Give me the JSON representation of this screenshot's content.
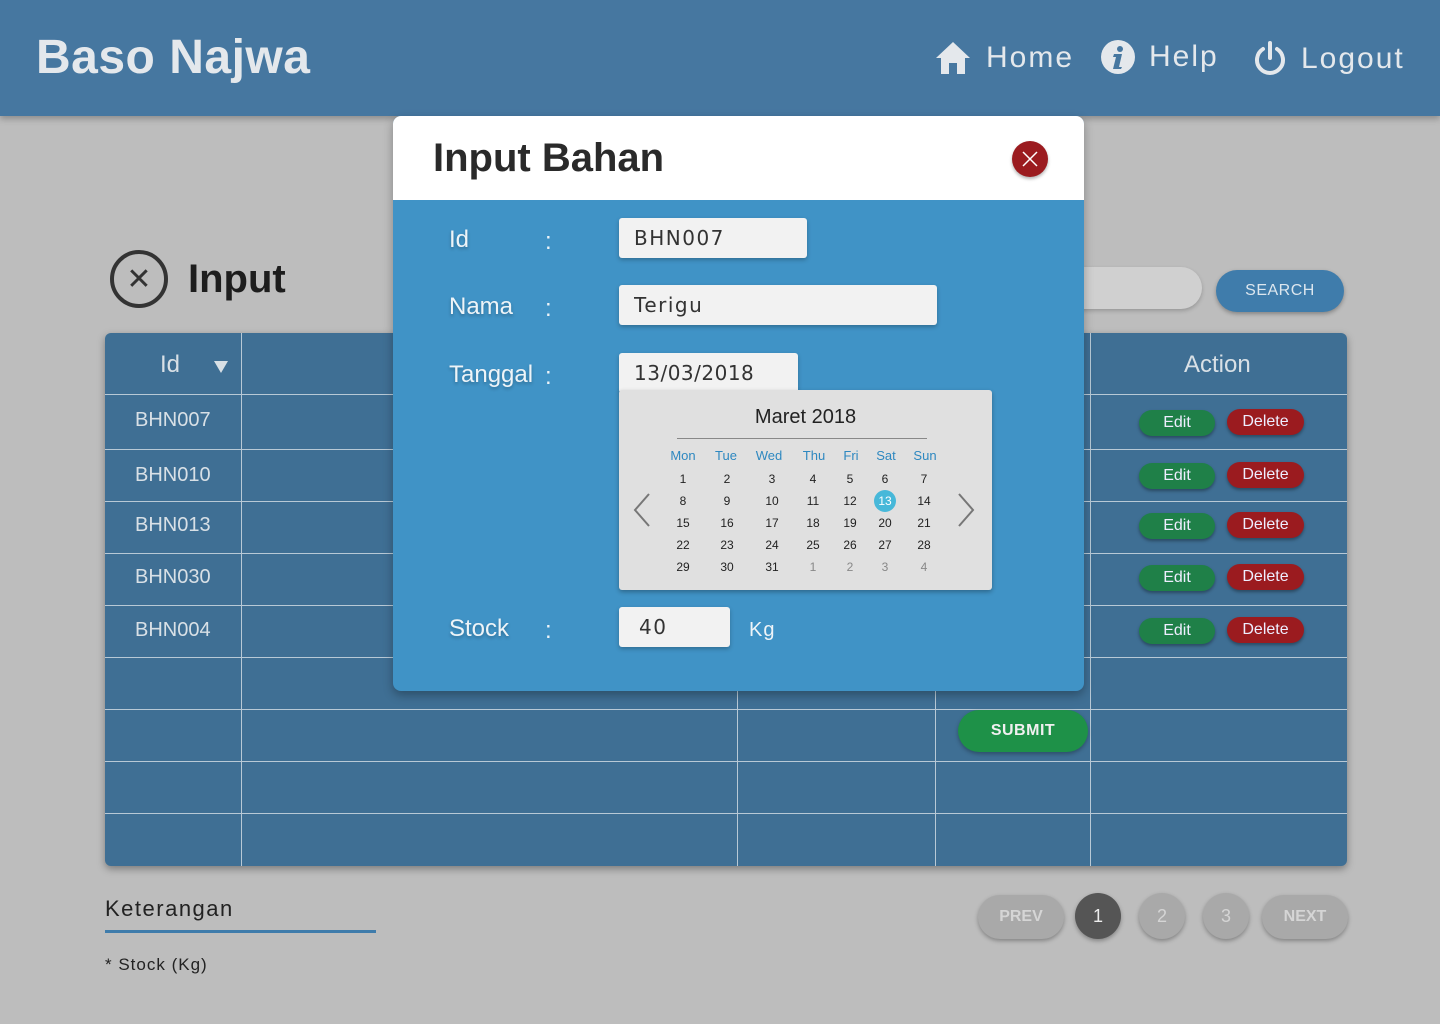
{
  "brand": "Baso Najwa",
  "nav": {
    "home": "Home",
    "help": "Help",
    "logout": "Logout"
  },
  "page": {
    "title": "Input",
    "search_button": "SEARCH"
  },
  "table": {
    "headers": {
      "id": "Id",
      "action": "Action"
    },
    "rows": [
      {
        "id": "BHN007"
      },
      {
        "id": "BHN010"
      },
      {
        "id": "BHN013"
      },
      {
        "id": "BHN030"
      },
      {
        "id": "BHN004"
      }
    ],
    "edit_label": "Edit",
    "delete_label": "Delete"
  },
  "submit_label": "SUBMIT",
  "keterangan": {
    "title": "Keterangan",
    "note": "* Stock (Kg)"
  },
  "pagination": {
    "prev": "PREV",
    "next": "NEXT",
    "pages": [
      "1",
      "2",
      "3"
    ],
    "current": "1"
  },
  "modal": {
    "title": "Input Bahan",
    "fields": {
      "id": {
        "label": "Id",
        "value": "BHN007"
      },
      "nama": {
        "label": "Nama",
        "value": "Terigu"
      },
      "tanggal": {
        "label": "Tanggal",
        "value": "13/03/2018"
      },
      "stock": {
        "label": "Stock",
        "value": "40",
        "unit": "Kg"
      }
    },
    "colon": ":"
  },
  "calendar": {
    "title": "Maret 2018",
    "weekdays": [
      "Mon",
      "Tue",
      "Wed",
      "Thu",
      "Fri",
      "Sat",
      "Sun"
    ],
    "weeks": [
      [
        "1",
        "2",
        "3",
        "4",
        "5",
        "6",
        "7"
      ],
      [
        "8",
        "9",
        "10",
        "11",
        "12",
        "13",
        "14"
      ],
      [
        "15",
        "16",
        "17",
        "18",
        "19",
        "20",
        "21"
      ],
      [
        "22",
        "23",
        "24",
        "25",
        "26",
        "27",
        "28"
      ],
      [
        "29",
        "30",
        "31",
        "1",
        "2",
        "3",
        "4"
      ]
    ],
    "selected": "13"
  },
  "colors": {
    "header": "#4677a0",
    "modal": "#4093c6",
    "table": "#3f6f94",
    "edit": "#1f8048",
    "delete": "#9b1b1f",
    "selected_day": "#47b8d9"
  }
}
